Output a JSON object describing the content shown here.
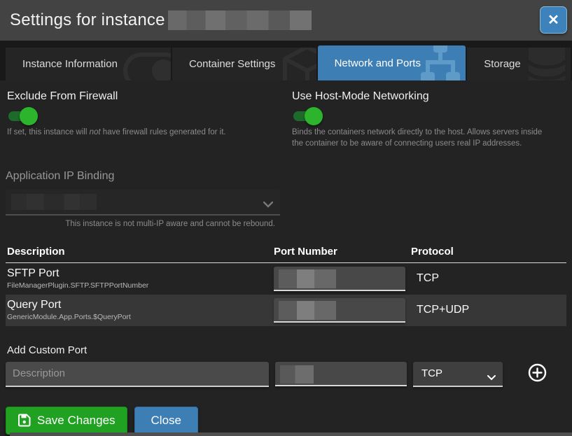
{
  "window": {
    "title": "Settings for instance"
  },
  "close_icon": "✕",
  "tabs": [
    {
      "label": "Instance Information"
    },
    {
      "label": "Container Settings"
    },
    {
      "label": "Network and Ports"
    },
    {
      "label": "Storage"
    }
  ],
  "firewall": {
    "label": "Exclude From Firewall",
    "state": "on",
    "help_before": "If set, this instance will ",
    "help_em": "not",
    "help_after": " have firewall rules generated for it."
  },
  "hostmode": {
    "label": "Use Host-Mode Networking",
    "state": "on",
    "help": "Binds the containers network directly to the host. Allows servers inside the container to be aware of connecting users real IP addresses."
  },
  "ip_binding": {
    "label": "Application IP Binding",
    "help": "This instance is not multi-IP aware and cannot be rebound."
  },
  "ports": {
    "headers": {
      "description": "Description",
      "port": "Port Number",
      "protocol": "Protocol"
    },
    "rows": [
      {
        "name": "SFTP Port",
        "setting_key": "FileManagerPlugin.SFTP.SFTPPortNumber",
        "protocol": "TCP"
      },
      {
        "name": "Query Port",
        "setting_key": "GenericModule.App.Ports.$QueryPort",
        "protocol": "TCP+UDP"
      }
    ]
  },
  "add_port": {
    "label": "Add Custom Port",
    "description_placeholder": "Description",
    "protocol": "TCP"
  },
  "buttons": {
    "save": "Save Changes",
    "close": "Close"
  },
  "colors": {
    "accent_blue": "#3d7eb4",
    "save_green": "#21a121",
    "toggle_green": "#2cb52c",
    "titlebar": "#434343"
  }
}
